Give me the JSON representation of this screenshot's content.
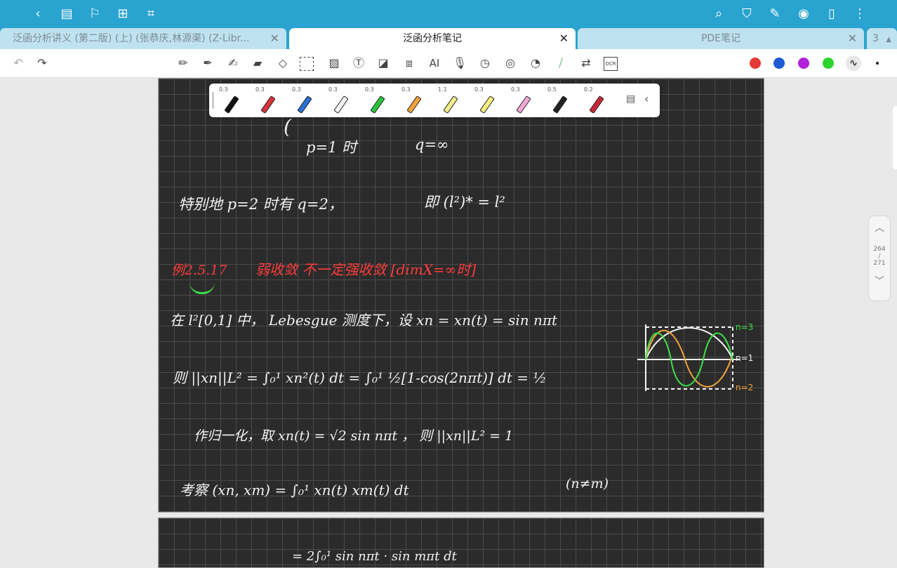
{
  "topbar": {
    "left_icons": [
      "back-icon",
      "sidebar-icon",
      "bookmark-icon",
      "add-page-icon",
      "crop-icon"
    ],
    "right_icons": [
      "search-icon",
      "shirt-icon",
      "pen-edit-icon",
      "eye-icon",
      "phone-icon",
      "more-icon"
    ]
  },
  "tabs": [
    {
      "label": "泛函分析讲义 (第二版) (上) (张恭庆,林源渠) (Z-Libr...",
      "active": false
    },
    {
      "label": "泛函分析笔记",
      "active": true
    },
    {
      "label": "PDE笔记",
      "active": false
    },
    {
      "label": "3",
      "active": false
    }
  ],
  "tab_close_glyph": "✕",
  "toolbar": {
    "tools": [
      "pencil-icon",
      "fountain-pen-icon",
      "pen-icon",
      "highlighter-icon",
      "eraser-icon",
      "lasso-icon",
      "image-icon",
      "text-box-icon",
      "shape-icon",
      "ocr-text-icon",
      "ai-icon",
      "mic-icon",
      "timer-icon",
      "laser-icon",
      "sticker-icon",
      "ruler-icon",
      "translate-icon",
      "ocr-icon"
    ],
    "text_tools": {
      "ai": "AI",
      "ocr": "OCR"
    },
    "colors": [
      "#e53935",
      "#1e5bd6",
      "#b321d8",
      "#2bd42f"
    ]
  },
  "pen_bar": {
    "pens": [
      {
        "size": "0.3",
        "color": "#111111"
      },
      {
        "size": "0.3",
        "color": "#d8323b"
      },
      {
        "size": "0.3",
        "color": "#2a6fd6"
      },
      {
        "size": "0.3",
        "color": "#f4f4f4"
      },
      {
        "size": "0.3",
        "color": "#29c43a"
      },
      {
        "size": "0.3",
        "color": "#f2a33a"
      },
      {
        "size": "1.1",
        "color": "#f1ef8a"
      },
      {
        "size": "0.3",
        "color": "#f6f07a"
      },
      {
        "size": "0.3",
        "color": "#f1a8d8"
      },
      {
        "size": "0.5",
        "color": "#222222"
      },
      {
        "size": "0.2",
        "color": "#c9283a"
      }
    ]
  },
  "notes": {
    "line1_a": "p=1 时",
    "line1_b": "q=∞",
    "line2_a": "特别地 p=2 时有 q=2，",
    "line2_b": "即 (l²)* = l²",
    "line3_a": "例2.5.17",
    "line3_b": "弱收敛 不一定强收敛 [dimX=∞时]",
    "line4": "在 l²[0,1] 中， Lebesgue 测度下，设 xn = xn(t) = sin nπt",
    "line5": "则 ||xn||L² = ∫₀¹ xn²(t) dt = ∫₀¹ ½[1-cos(2nπt)] dt = ½",
    "line6": "作归一化，取 xn(t) = √2 sin nπt ， 则 ||xn||L² = 1",
    "line7": "考察 (xn, xm) = ∫₀¹ xn(t) xm(t) dt",
    "line7_b": "(n≠m)",
    "next_page": "= 2∫₀¹ sin nπt · sin mπt dt",
    "graph_labels": {
      "n3": "n=3",
      "n1": "n=1",
      "n2": "n=2"
    }
  },
  "pager": {
    "current": "264",
    "sep": "/",
    "total": "271"
  }
}
